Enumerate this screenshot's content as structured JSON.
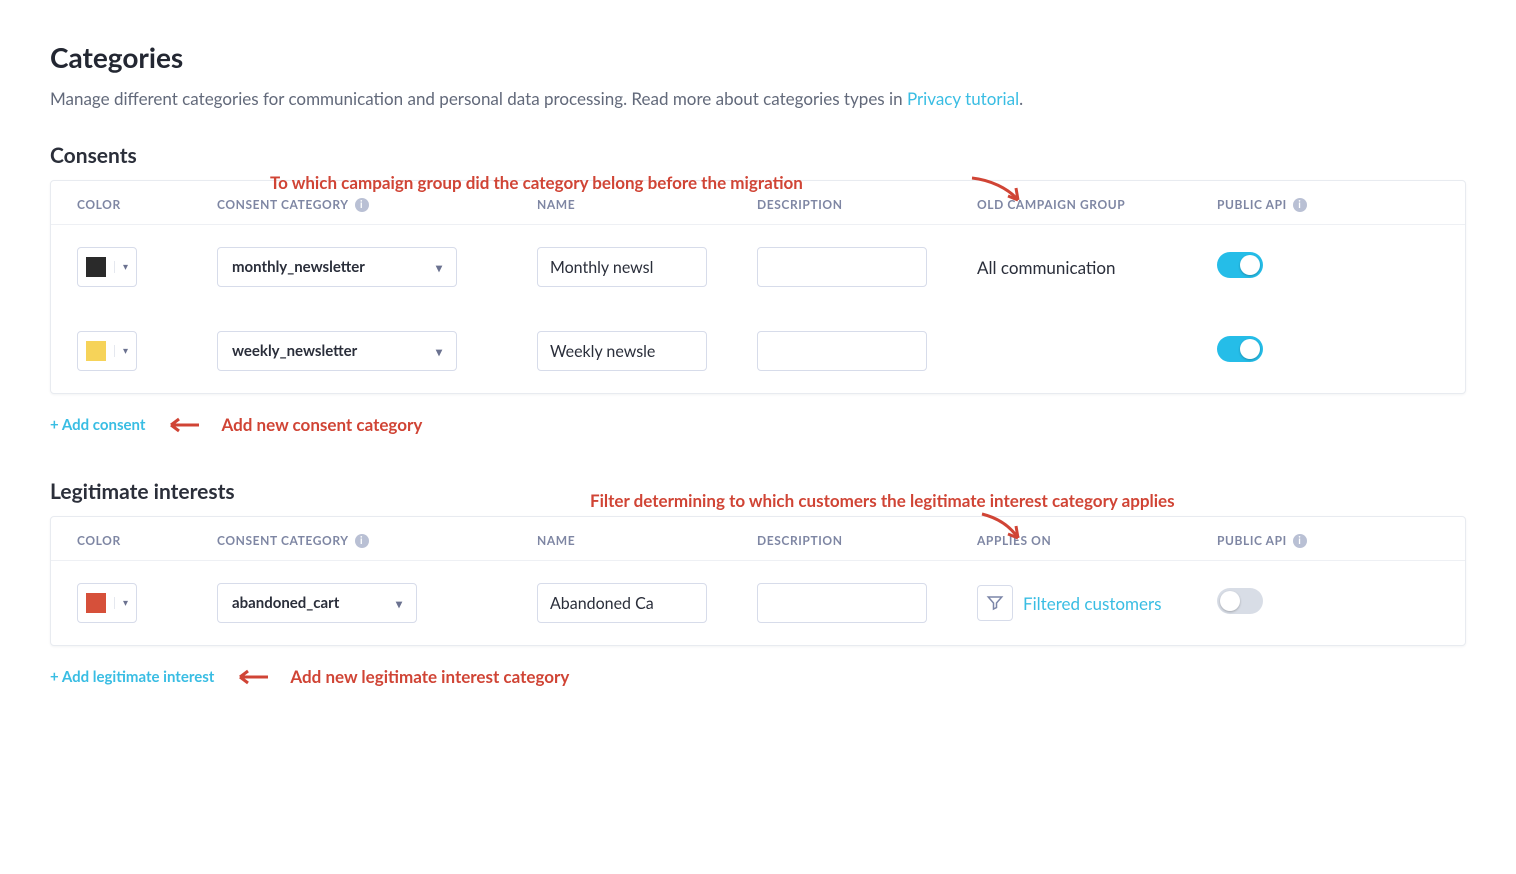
{
  "page": {
    "title": "Categories",
    "subtitle_pre": "Manage different categories for communication and personal data processing. Read more about categories types in ",
    "subtitle_link": "Privacy tutorial",
    "subtitle_post": "."
  },
  "consents": {
    "heading": "Consents",
    "annotation_top": "To which campaign group did the category belong before the migration",
    "headers": {
      "color": "COLOR",
      "category": "CONSENT CATEGORY",
      "name": "NAME",
      "description": "DESCRIPTION",
      "old_group": "OLD CAMPAIGN GROUP",
      "public_api": "PUBLIC API"
    },
    "rows": [
      {
        "color": "#2a2a2a",
        "category": "monthly_newsletter",
        "name": "Monthly newsl",
        "description": "",
        "old_group": "All communication",
        "public_api": true
      },
      {
        "color": "#f6d359",
        "category": "weekly_newsletter",
        "name": "Weekly newsle",
        "description": "",
        "old_group": "",
        "public_api": true
      }
    ],
    "add_label": "+ Add consent",
    "add_annotation": "Add new consent category"
  },
  "legitimate": {
    "heading": "Legitimate interests",
    "annotation_top": "Filter determining to which customers the legitimate interest category applies",
    "headers": {
      "color": "COLOR",
      "category": "CONSENT CATEGORY",
      "name": "NAME",
      "description": "DESCRIPTION",
      "applies_on": "APPLIES ON",
      "public_api": "PUBLIC API"
    },
    "rows": [
      {
        "color": "#d6503a",
        "category": "abandoned_cart",
        "name": "Abandoned Ca",
        "description": "",
        "applies_on": "Filtered customers",
        "public_api": false
      }
    ],
    "add_label": "+ Add legitimate interest",
    "add_annotation": "Add new legitimate interest category"
  },
  "icons": {
    "info": "i"
  }
}
